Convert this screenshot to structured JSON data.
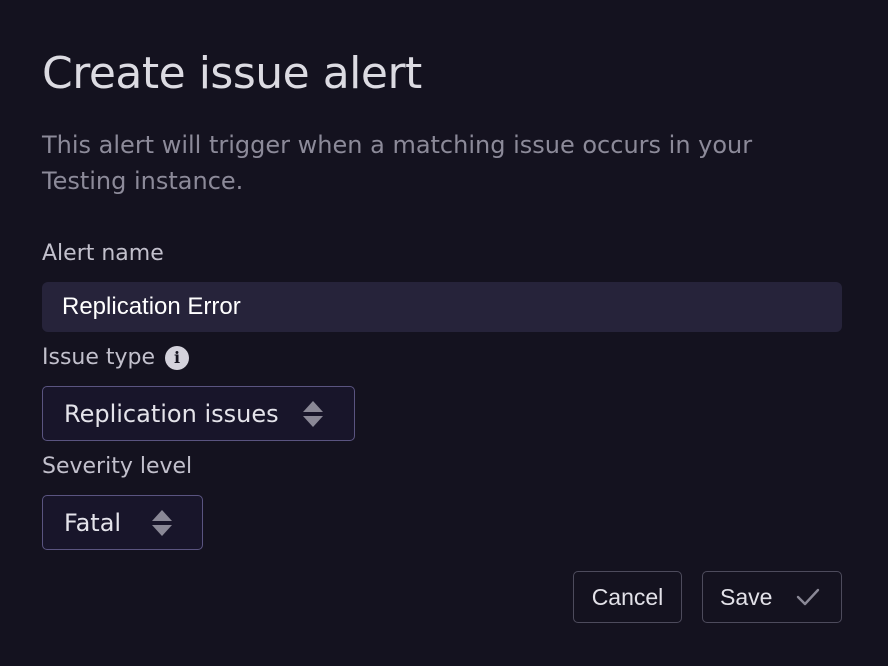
{
  "dialog": {
    "title": "Create issue alert",
    "description": "This alert will trigger when a matching issue occurs in your Testing instance."
  },
  "form": {
    "alert_name": {
      "label": "Alert name",
      "value": "Replication Error"
    },
    "issue_type": {
      "label": "Issue type",
      "info_icon": "info-icon",
      "selected": "Replication issues"
    },
    "severity": {
      "label": "Severity level",
      "selected": "Fatal"
    }
  },
  "actions": {
    "cancel_label": "Cancel",
    "save_label": "Save",
    "save_icon": "checkmark-icon"
  },
  "colors": {
    "background": "#14121f",
    "input_background": "#26233a",
    "select_border": "#5a5480",
    "button_border": "#4d4b5c"
  }
}
